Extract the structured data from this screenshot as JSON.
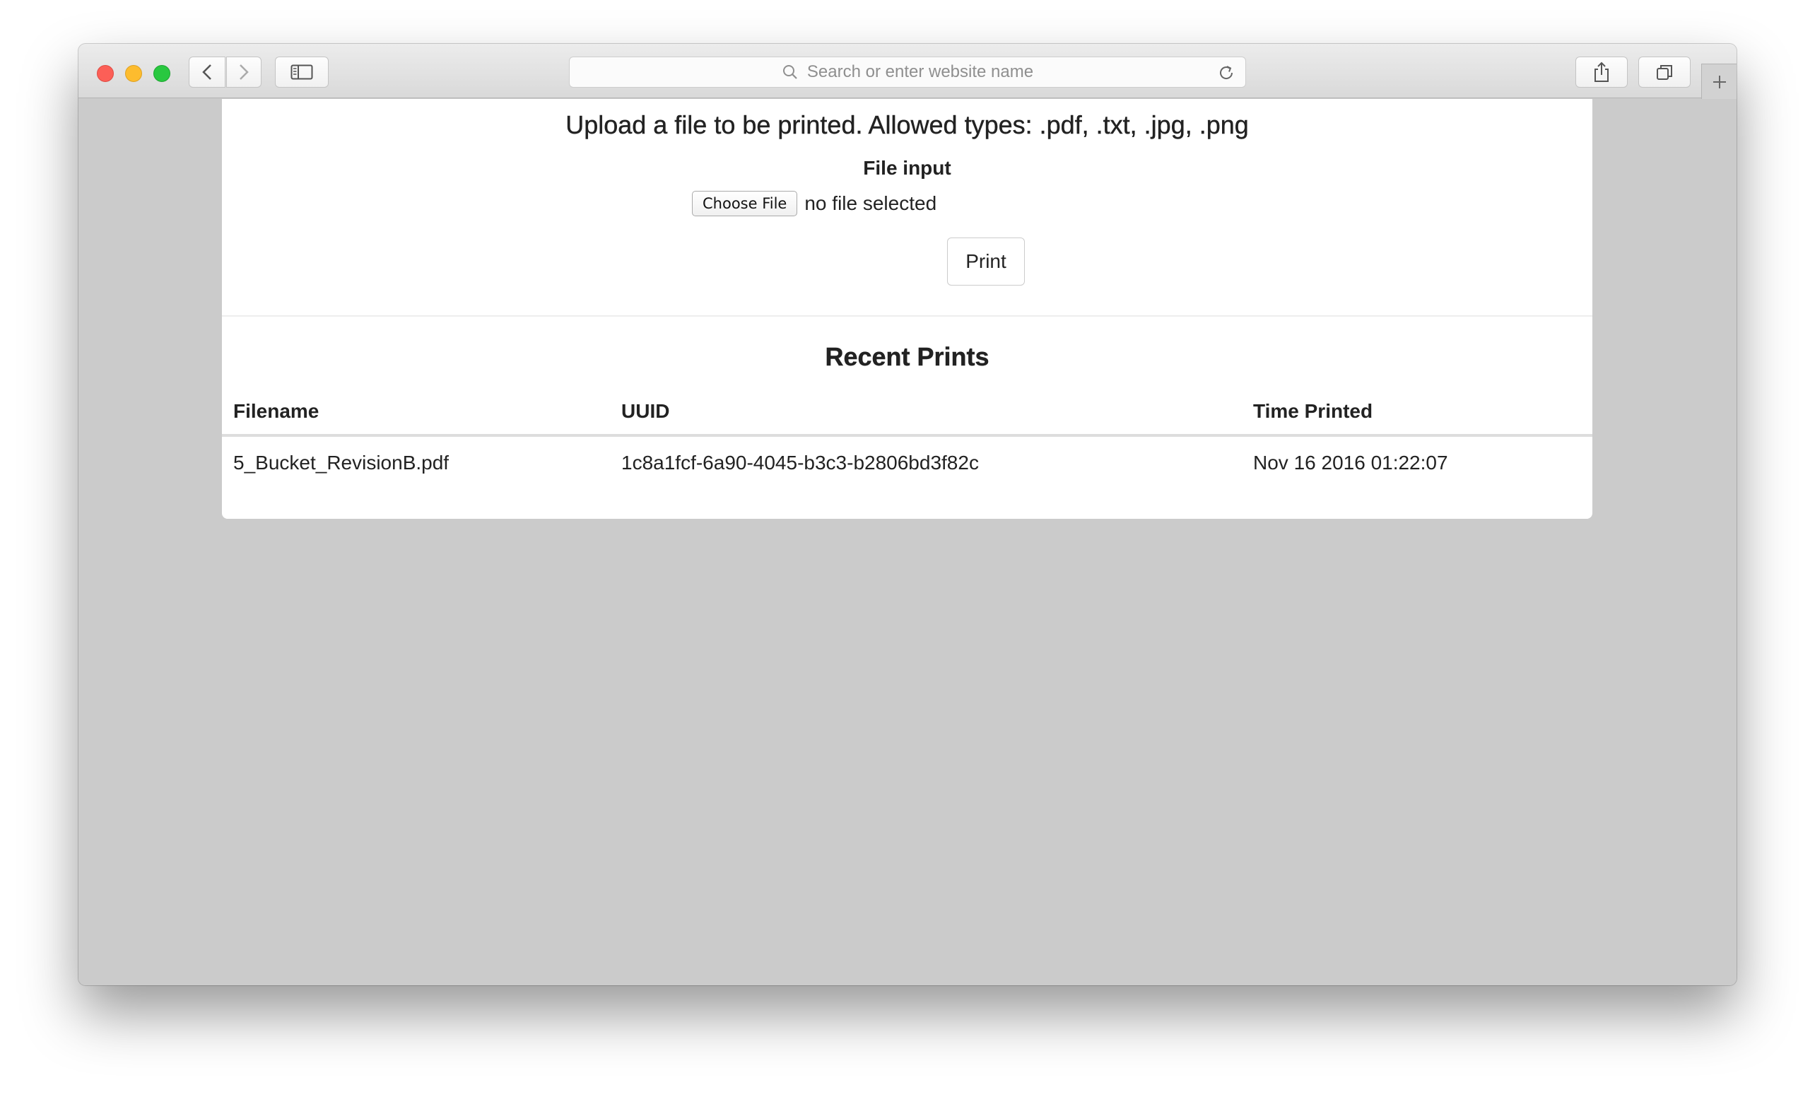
{
  "browser": {
    "address_placeholder": "Search or enter website name",
    "icons": [
      "back-chevron-icon",
      "forward-chevron-icon",
      "sidebar-icon",
      "search-icon",
      "reload-icon",
      "share-icon",
      "tabs-icon",
      "plus-icon"
    ]
  },
  "upload": {
    "title": "Upload a file to be printed. Allowed types: .pdf, .txt, .jpg, .png",
    "file_label": "File input",
    "choose_button": "Choose File",
    "file_status": "no file selected",
    "print_button": "Print"
  },
  "recent": {
    "title": "Recent Prints",
    "columns": [
      "Filename",
      "UUID",
      "Time Printed"
    ],
    "rows": [
      {
        "filename": "5_Bucket_RevisionB.pdf",
        "uuid": "1c8a1fcf-6a90-4045-b3c3-b2806bd3f82c",
        "time": "Nov 16 2016 01:22:07"
      }
    ]
  },
  "colors": {
    "page_background": "#cbcbcb",
    "panel_background": "#ffffff",
    "close": "#fc5f57",
    "minimize": "#fdbc2e",
    "maximize": "#29c840"
  }
}
